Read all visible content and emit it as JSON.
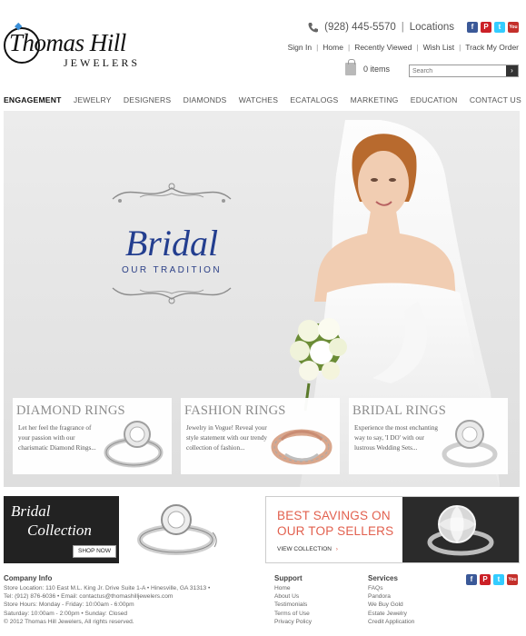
{
  "brand": {
    "name": "Thomas Hill",
    "sub": "JEWELERS"
  },
  "header": {
    "phone": "(928) 445-5570",
    "locations": "Locations",
    "links": [
      "Sign In",
      "Home",
      "Recently Viewed",
      "Wish List",
      "Track My Order"
    ],
    "cart": "0 items",
    "search_placeholder": "Search"
  },
  "social": [
    {
      "name": "facebook-icon",
      "glyph": "f",
      "color": "#3b5998"
    },
    {
      "name": "pinterest-icon",
      "glyph": "P",
      "color": "#cb2027"
    },
    {
      "name": "twitter-icon",
      "glyph": "t",
      "color": "#33ccff"
    },
    {
      "name": "youtube-icon",
      "glyph": "You",
      "color": "#c4302b"
    }
  ],
  "nav": [
    "ENGAGEMENT",
    "JEWELRY",
    "DESIGNERS",
    "DIAMONDS",
    "WATCHES",
    "ECATALOGS",
    "MARKETING",
    "EDUCATION",
    "CONTACT US"
  ],
  "hero": {
    "title": "Bridal",
    "subtitle": "OUR TRADITION"
  },
  "promos": [
    {
      "title": "DIAMOND RINGS",
      "desc": "Let her feel the fragrance of your passion with our charismatic Diamond Rings..."
    },
    {
      "title": "FASHION RINGS",
      "desc": "Jewelry in Vogue! Reveal your style statement with our trendy collection of fashion..."
    },
    {
      "title": "BRIDAL RINGS",
      "desc": "Experience the most enchanting way to say, 'I DO' with our lustrous Wedding Sets..."
    }
  ],
  "banner_left": {
    "line1": "Bridal",
    "line2": "Collection",
    "button": "SHOP NOW"
  },
  "banner_right": {
    "line1": "BEST SAVINGS ON",
    "line2": "OUR TOP SELLERS",
    "link": "VIEW COLLECTION"
  },
  "footer": {
    "company_title": "Company Info",
    "company_lines": [
      "Store Location: 110 East M.L. King Jr. Drive Suite 1-A • Hinesville,  GA  31313 •",
      "Tel: (912) 876-6036 • Email: contactus@thomashilljewelers.com",
      "Store Hours: Monday - Friday: 10:00am - 6:00pm",
      "Saturday: 10:00am - 2:00pm • Sunday: Closed",
      "© 2012 Thomas Hill Jewelers, All rights reserved."
    ],
    "support_title": "Support",
    "support_links": [
      "Home",
      "About Us",
      "Testimonials",
      "Terms of Use",
      "Privacy Policy"
    ],
    "services_title": "Services",
    "services_links": [
      "FAQs",
      "Pandora",
      "We Buy Gold",
      "Estate Jewelry",
      "Credit Application"
    ]
  }
}
